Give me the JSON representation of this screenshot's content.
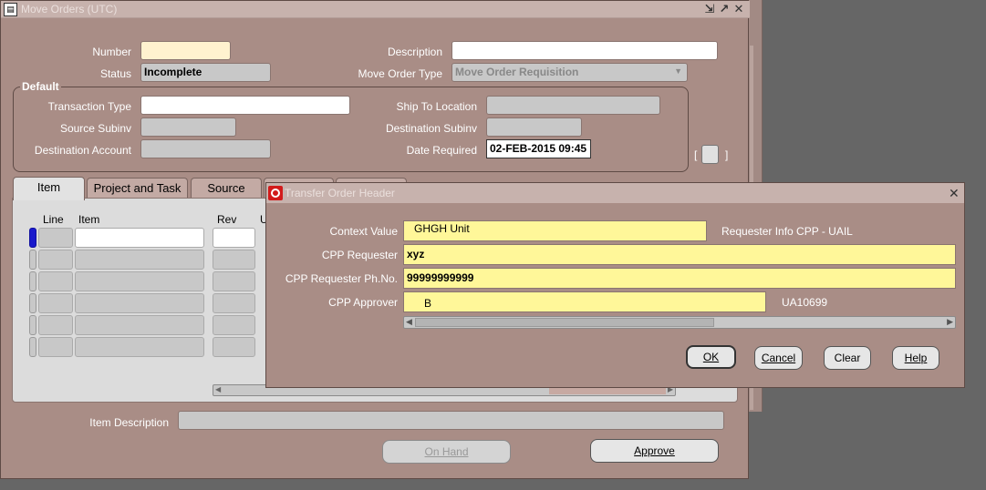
{
  "window": {
    "title": "Move Orders (UTC)",
    "app_icon": "form-icon",
    "controls": [
      "⇲",
      "↗",
      "✕"
    ]
  },
  "header": {
    "number_label": "Number",
    "number_value": "",
    "description_label": "Description",
    "description_value": "",
    "status_label": "Status",
    "status_value": "Incomplete",
    "move_order_type_label": "Move Order Type",
    "move_order_type_value": "Move Order Requisition"
  },
  "default_group": {
    "title": "Default",
    "transaction_type_label": "Transaction Type",
    "ship_to_location_label": "Ship To Location",
    "source_subinv_label": "Source Subinv",
    "destination_subinv_label": "Destination Subinv",
    "destination_account_label": "Destination Account",
    "date_required_label": "Date Required",
    "date_required_value": "02-FEB-2015 09:45",
    "bracket_left": "[",
    "bracket_right": "]"
  },
  "tabs": [
    {
      "label": "Item",
      "active": true
    },
    {
      "label": "Project and Task",
      "active": false
    },
    {
      "label": "Source",
      "active": false
    },
    {
      "label": "",
      "active": false
    },
    {
      "label": "",
      "active": false
    }
  ],
  "lines_table": {
    "columns": [
      "Line",
      "Item",
      "Rev",
      "U"
    ],
    "row_count": 6
  },
  "footer": {
    "item_description_label": "Item Description",
    "on_hand_label": "On Hand",
    "approve_label": "Approve"
  },
  "dialog": {
    "title": "Transfer Order Header",
    "context_value_label": "Context Value",
    "context_value": "GHGH Unit",
    "requester_info": "Requester Info CPP - UAIL",
    "cpp_requester_label": "CPP Requester",
    "cpp_requester_value": "xyz",
    "cpp_requester_phone_label": "CPP Requester Ph.No.",
    "cpp_requester_phone_value": "99999999999",
    "cpp_approver_label": "CPP Approver",
    "cpp_approver_value": "B",
    "cpp_approver_id": "UA10699",
    "ok_label": "OK",
    "cancel_label": "Cancel",
    "clear_label": "Clear",
    "help_label": "Help",
    "close_glyph": "✕"
  },
  "colors": {
    "window_bg": "#a98d86",
    "titlebar": "#c7b2ad",
    "desktop": "#666666",
    "flex_field": "#fff799",
    "required_field": "#fff2cf",
    "current_row": "#1a1acc",
    "oracle_red": "#d21a1a"
  }
}
